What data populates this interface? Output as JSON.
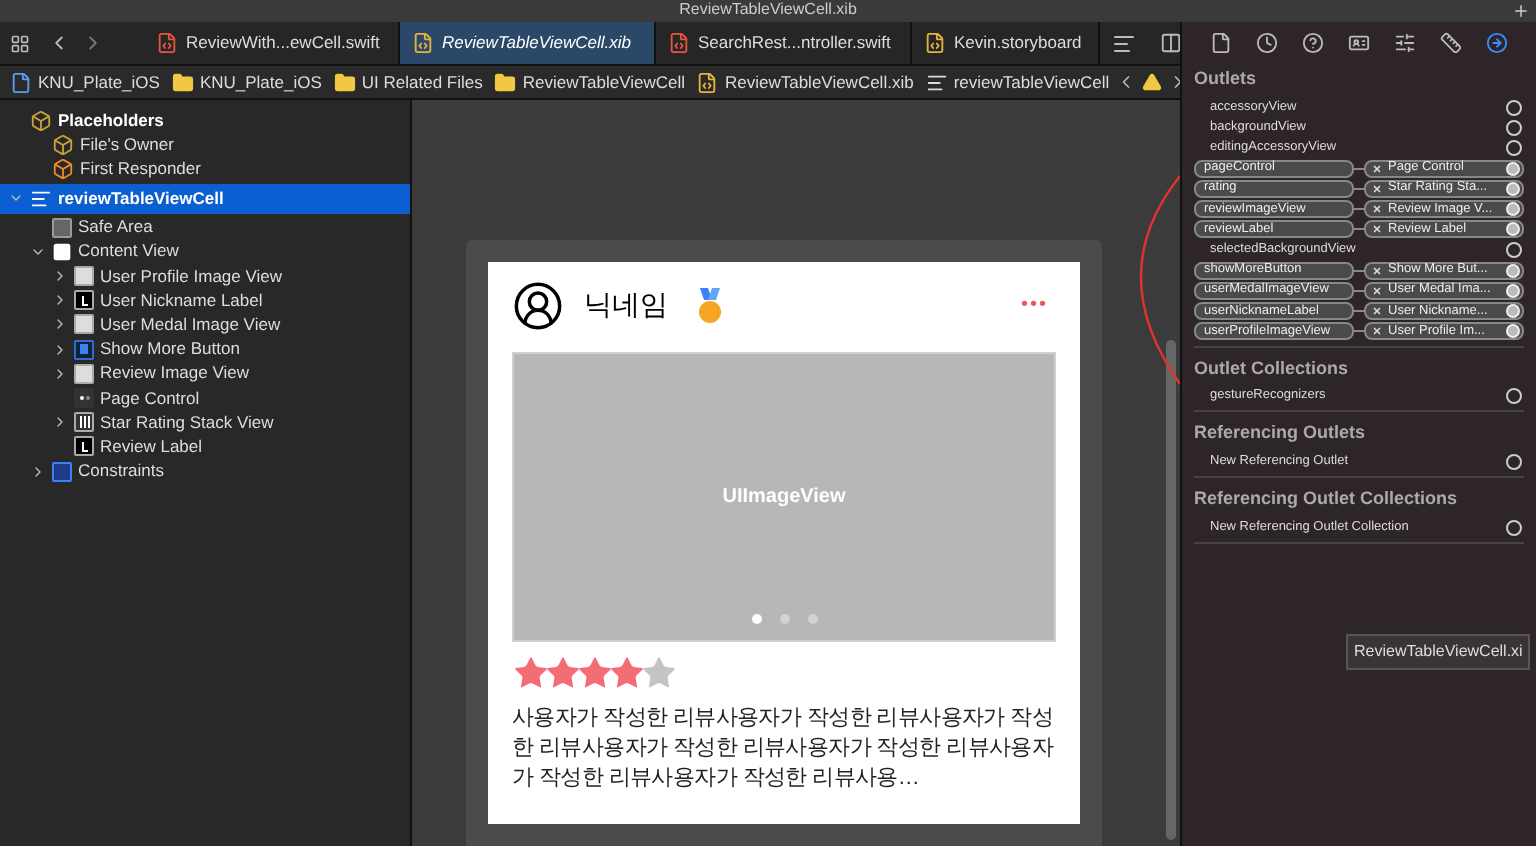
{
  "window": {
    "title": "ReviewTableViewCell.xib"
  },
  "tabs": [
    {
      "label": "ReviewWith...ewCell.swift",
      "kind": "swift",
      "selected": false
    },
    {
      "label": "ReviewTableViewCell.xib",
      "kind": "xib",
      "selected": true
    },
    {
      "label": "SearchRest...ntroller.swift",
      "kind": "swift",
      "selected": false
    },
    {
      "label": "Kevin.storyboard",
      "kind": "storyboard",
      "selected": false
    }
  ],
  "breadcrumb": [
    {
      "label": "KNU_Plate_iOS",
      "kind": "project"
    },
    {
      "label": "KNU_Plate_iOS",
      "kind": "folder"
    },
    {
      "label": "UI Related Files",
      "kind": "folder"
    },
    {
      "label": "ReviewTableViewCell",
      "kind": "folder"
    },
    {
      "label": "ReviewTableViewCell.xib",
      "kind": "xib"
    },
    {
      "label": "reviewTableViewCell",
      "kind": "cell"
    }
  ],
  "outline": [
    {
      "label": "Placeholders",
      "kind": "placeholder",
      "bold": true,
      "children": [
        {
          "label": "File's Owner",
          "kind": "placeholder"
        },
        {
          "label": "First Responder",
          "kind": "responder"
        }
      ]
    },
    {
      "label": "reviewTableViewCell",
      "kind": "cell",
      "bold": true,
      "selected": true,
      "expanded": true,
      "children": [
        {
          "label": "Safe Area",
          "kind": "safearea"
        },
        {
          "label": "Content View",
          "kind": "view",
          "expanded": true,
          "children": [
            {
              "label": "User Profile Image View",
              "kind": "image",
              "expanded": false
            },
            {
              "label": "User Nickname Label",
              "kind": "label",
              "expanded": false
            },
            {
              "label": "User Medal Image View",
              "kind": "image",
              "expanded": false
            },
            {
              "label": "Show More Button",
              "kind": "button",
              "expanded": false
            },
            {
              "label": "Review Image View",
              "kind": "image",
              "expanded": false
            },
            {
              "label": "Page Control",
              "kind": "pagecontrol"
            },
            {
              "label": "Star Rating Stack View",
              "kind": "stack",
              "expanded": false
            },
            {
              "label": "Review Label",
              "kind": "label"
            }
          ]
        },
        {
          "label": "Constraints",
          "kind": "constraints",
          "expanded": false
        }
      ]
    }
  ],
  "cell": {
    "nickname": "닉네임",
    "more": "•••",
    "image_label": "UIImageView",
    "pages": [
      {
        "selected": true
      },
      {
        "selected": false
      },
      {
        "selected": false
      }
    ],
    "stars": 4,
    "review": "사용자가 작성한 리뷰사용자가 작성한 리뷰사용자가 작성한 리뷰사용자가 작성한 리뷰사용자가 작성한 리뷰사용자가 작성한 리뷰사용자가 작성한 리뷰사용…"
  },
  "inspector_tabs": [
    {
      "kind": "file",
      "selected": false
    },
    {
      "kind": "history",
      "selected": false
    },
    {
      "kind": "help",
      "selected": false
    },
    {
      "kind": "identity",
      "selected": false
    },
    {
      "kind": "attributes",
      "selected": false
    },
    {
      "kind": "size",
      "selected": false
    },
    {
      "kind": "connections",
      "selected": true
    }
  ],
  "sections": [
    {
      "title": "Outlets",
      "rows": [
        {
          "name": "accessoryView",
          "connected": false
        },
        {
          "name": "backgroundView",
          "connected": false
        },
        {
          "name": "editingAccessoryView",
          "connected": false
        },
        {
          "name": "pageControl",
          "connected": true,
          "target": "Page Control"
        },
        {
          "name": "rating",
          "connected": true,
          "target": "Star Rating Sta..."
        },
        {
          "name": "reviewImageView",
          "connected": true,
          "target": "Review Image V..."
        },
        {
          "name": "reviewLabel",
          "connected": true,
          "target": "Review Label"
        },
        {
          "name": "selectedBackgroundView",
          "connected": false
        },
        {
          "name": "showMoreButton",
          "connected": true,
          "target": "Show More But..."
        },
        {
          "name": "userMedalImageView",
          "connected": true,
          "target": "User Medal Ima..."
        },
        {
          "name": "userNicknameLabel",
          "connected": true,
          "target": "User Nickname..."
        },
        {
          "name": "userProfileImageView",
          "connected": true,
          "target": "User Profile Im..."
        }
      ]
    },
    {
      "title": "Outlet Collections",
      "rows": [
        {
          "name": "gestureRecognizers",
          "connected": false
        }
      ]
    },
    {
      "title": "Referencing Outlets",
      "rows": [
        {
          "name": "New Referencing Outlet",
          "connected": false
        }
      ]
    },
    {
      "title": "Referencing Outlet Collections",
      "rows": [
        {
          "name": "New Referencing Outlet Collection",
          "connected": false
        }
      ]
    }
  ],
  "tooltip": "ReviewTableViewCell.xi"
}
